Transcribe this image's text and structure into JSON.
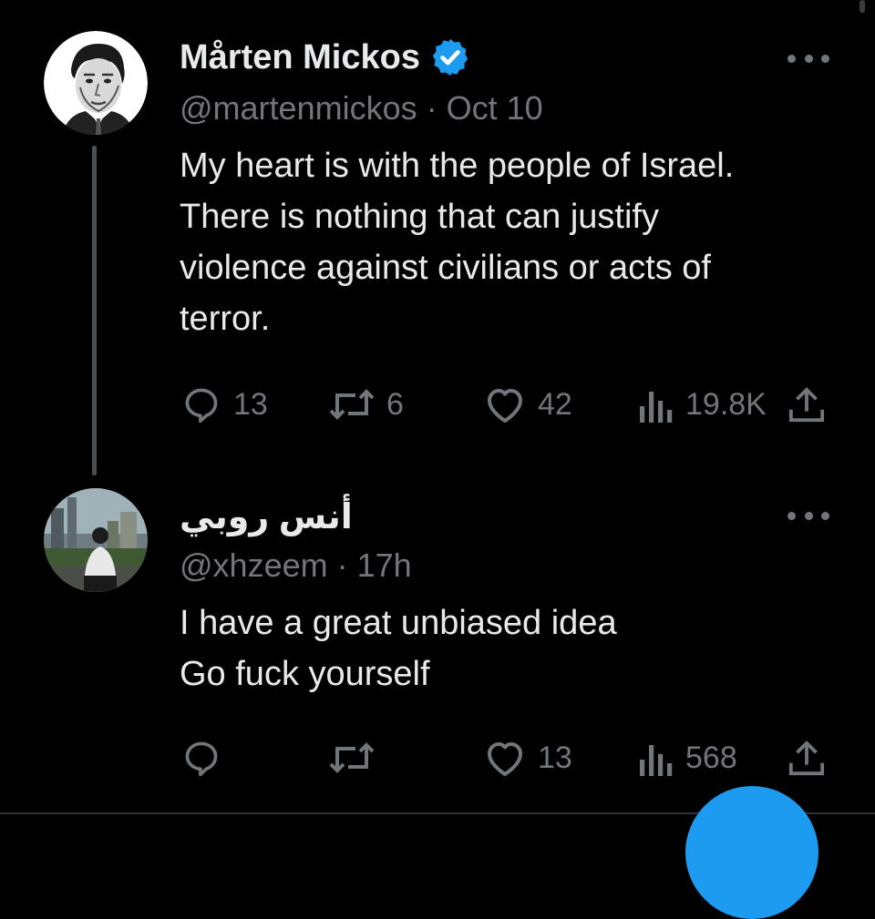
{
  "tweets": [
    {
      "display_name": "Mårten Mickos",
      "verified": true,
      "handle": "@martenmickos",
      "separator": "·",
      "time": "Oct 10",
      "text_lines": [
        "My heart is with the people of Israel.",
        "There is nothing that can justify",
        "violence against civilians or acts of",
        "terror."
      ],
      "replies": "13",
      "reposts": "6",
      "likes": "42",
      "views": "19.8K"
    },
    {
      "display_name": "أنس روبي",
      "verified": false,
      "handle": "@xhzeem",
      "separator": "·",
      "time": "17h",
      "text_lines": [
        "I have a great unbiased idea",
        "Go fuck yourself"
      ],
      "replies": "",
      "reposts": "",
      "likes": "13",
      "views": "568"
    }
  ],
  "colors": {
    "background": "#000000",
    "text": "#e7e9ea",
    "secondary": "#71767b",
    "verified_blue": "#1d9bf0",
    "fab": "#1d9bf0"
  },
  "icons": [
    "reply-icon",
    "repost-icon",
    "like-icon",
    "views-icon",
    "share-icon",
    "more-icon",
    "verified-badge-icon"
  ]
}
